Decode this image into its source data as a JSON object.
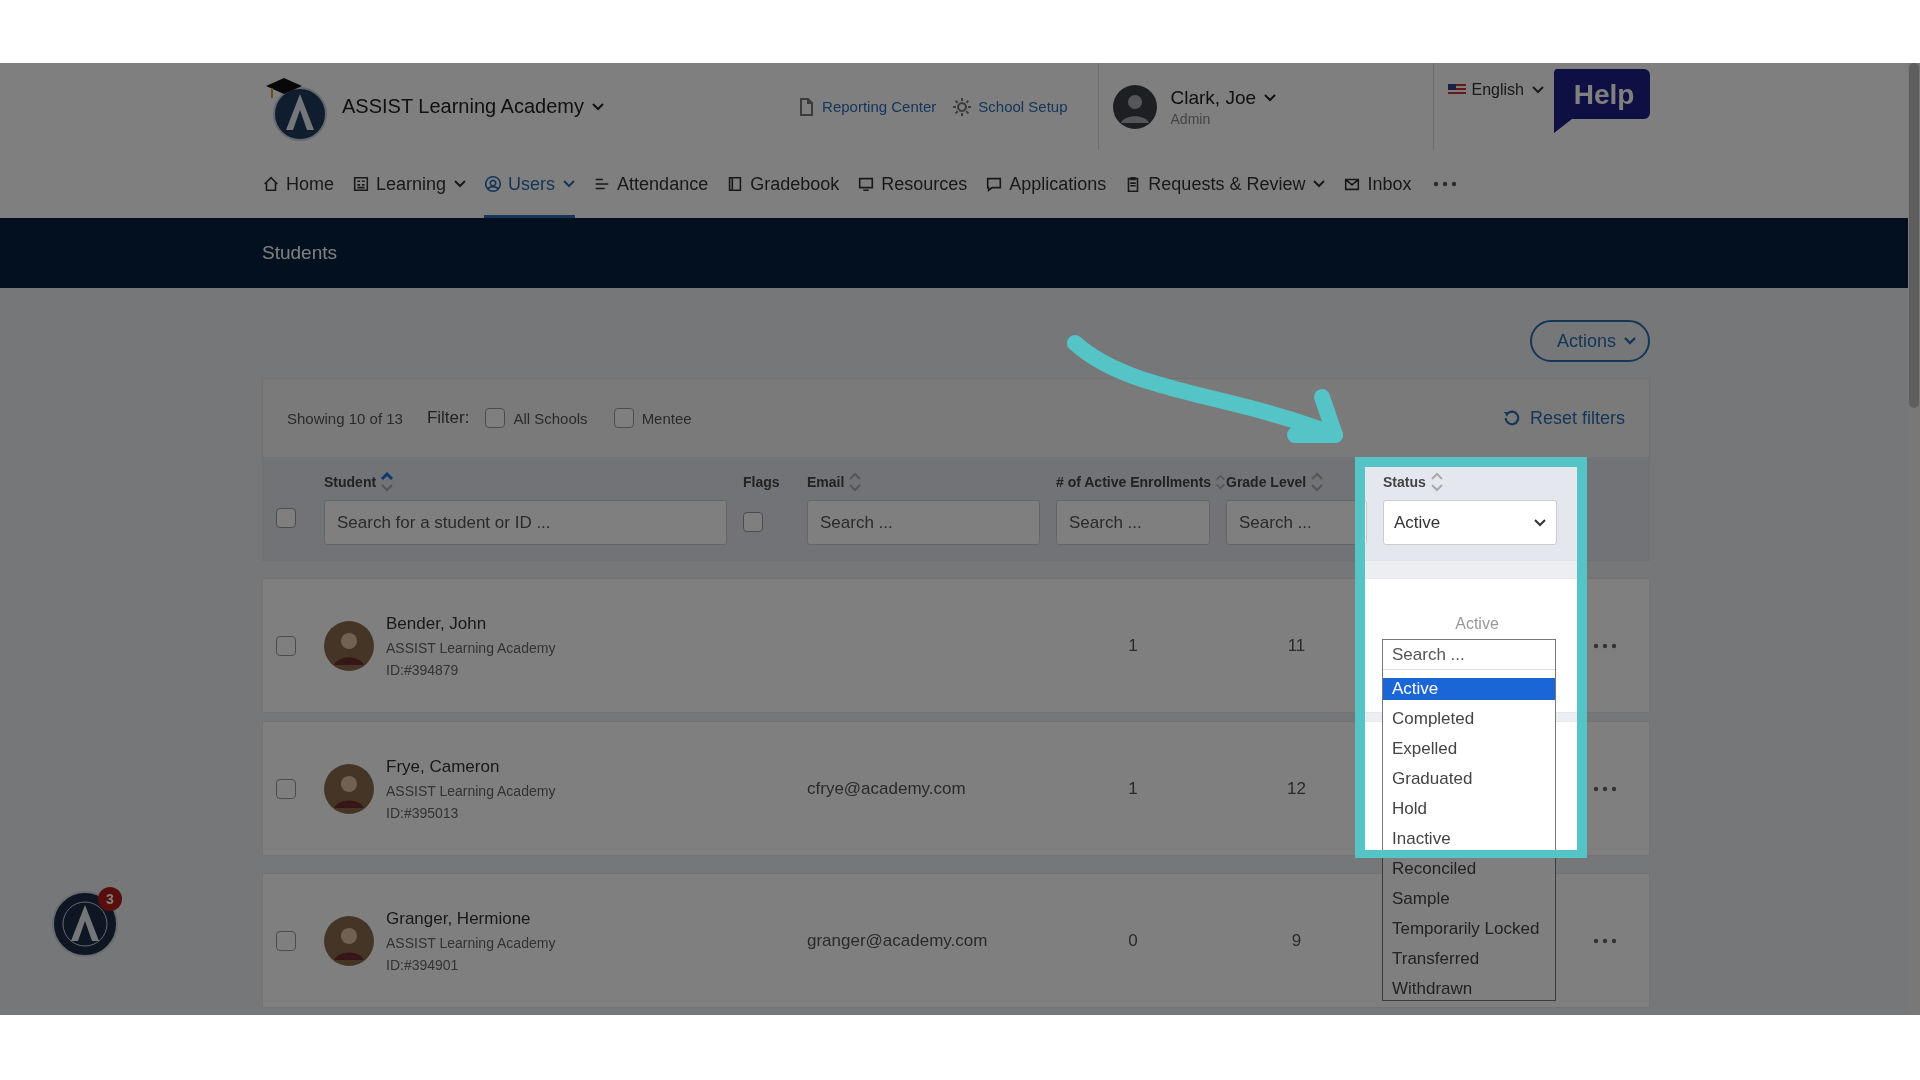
{
  "header": {
    "school": "ASSIST Learning Academy",
    "links": [
      {
        "label": "Reporting Center",
        "kind": "report"
      },
      {
        "label": "School Setup",
        "kind": "setup"
      }
    ],
    "user": {
      "name": "Clark, Joe",
      "role": "Admin"
    },
    "language": "English",
    "help": "Help"
  },
  "nav": [
    {
      "label": "Home",
      "kind": "home",
      "dropdown": false,
      "selected": false
    },
    {
      "label": "Learning",
      "kind": "learning",
      "dropdown": true,
      "selected": false
    },
    {
      "label": "Users",
      "kind": "users",
      "dropdown": true,
      "selected": true
    },
    {
      "label": "Attendance",
      "kind": "attendance",
      "dropdown": false,
      "selected": false
    },
    {
      "label": "Gradebook",
      "kind": "gradebook",
      "dropdown": false,
      "selected": false
    },
    {
      "label": "Resources",
      "kind": "resources",
      "dropdown": false,
      "selected": false
    },
    {
      "label": "Applications",
      "kind": "applications",
      "dropdown": false,
      "selected": false
    },
    {
      "label": "Requests & Review",
      "kind": "requests",
      "dropdown": true,
      "selected": false
    },
    {
      "label": "Inbox",
      "kind": "inbox",
      "dropdown": false,
      "selected": false
    }
  ],
  "page_title": "Students",
  "actions": "Actions",
  "filter": {
    "showing": "Showing 10 of 13",
    "label": "Filter:",
    "options": [
      {
        "label": "All Schools",
        "checked": false
      },
      {
        "label": "Mentee",
        "checked": false
      }
    ],
    "reset": "Reset filters"
  },
  "table": {
    "select_all": {
      "checked": false
    },
    "columns": [
      {
        "label": "Student",
        "kind": "text",
        "sorted": true,
        "placeholder": "Search for a student or ID ..."
      },
      {
        "label": "Flags",
        "kind": "checkbox",
        "checked": false
      },
      {
        "label": "Email",
        "kind": "text",
        "sorted": false,
        "placeholder": "Search ..."
      },
      {
        "label": "# of Active Enrollments",
        "kind": "text",
        "sorted": false,
        "placeholder": "Search ..."
      },
      {
        "label": "Grade Level",
        "kind": "text",
        "sorted": false,
        "placeholder": "Search ..."
      },
      {
        "label": "Status",
        "kind": "select",
        "sorted": false,
        "value": "Active"
      }
    ],
    "rows": [
      {
        "name": "Bender, John",
        "school": "ASSIST Learning Academy",
        "id": "ID:#394879",
        "enrollments": "1",
        "grade": "11",
        "status": "Active",
        "checked": false
      },
      {
        "name": "Frye, Cameron",
        "school": "ASSIST Learning Academy",
        "id": "ID:#395013",
        "email": "cfrye@academy.com",
        "enrollments": "1",
        "grade": "12",
        "checked": false
      },
      {
        "name": "Granger, Hermione",
        "school": "ASSIST Learning Academy",
        "id": "ID:#394901",
        "email": "granger@academy.com",
        "enrollments": "0",
        "grade": "9",
        "checked": false
      }
    ]
  },
  "status_menu": {
    "placeholder": "Search ...",
    "options": [
      {
        "label": "Active",
        "selected": true
      },
      {
        "label": "Completed",
        "selected": false
      },
      {
        "label": "Expelled",
        "selected": false
      },
      {
        "label": "Graduated",
        "selected": false
      },
      {
        "label": "Hold",
        "selected": false
      },
      {
        "label": "Inactive",
        "selected": false
      },
      {
        "label": "Reconciled",
        "selected": false
      },
      {
        "label": "Sample",
        "selected": false
      },
      {
        "label": "Temporarily Locked",
        "selected": false
      },
      {
        "label": "Transferred",
        "selected": false
      },
      {
        "label": "Withdrawn",
        "selected": false
      }
    ]
  },
  "notifications": "3"
}
